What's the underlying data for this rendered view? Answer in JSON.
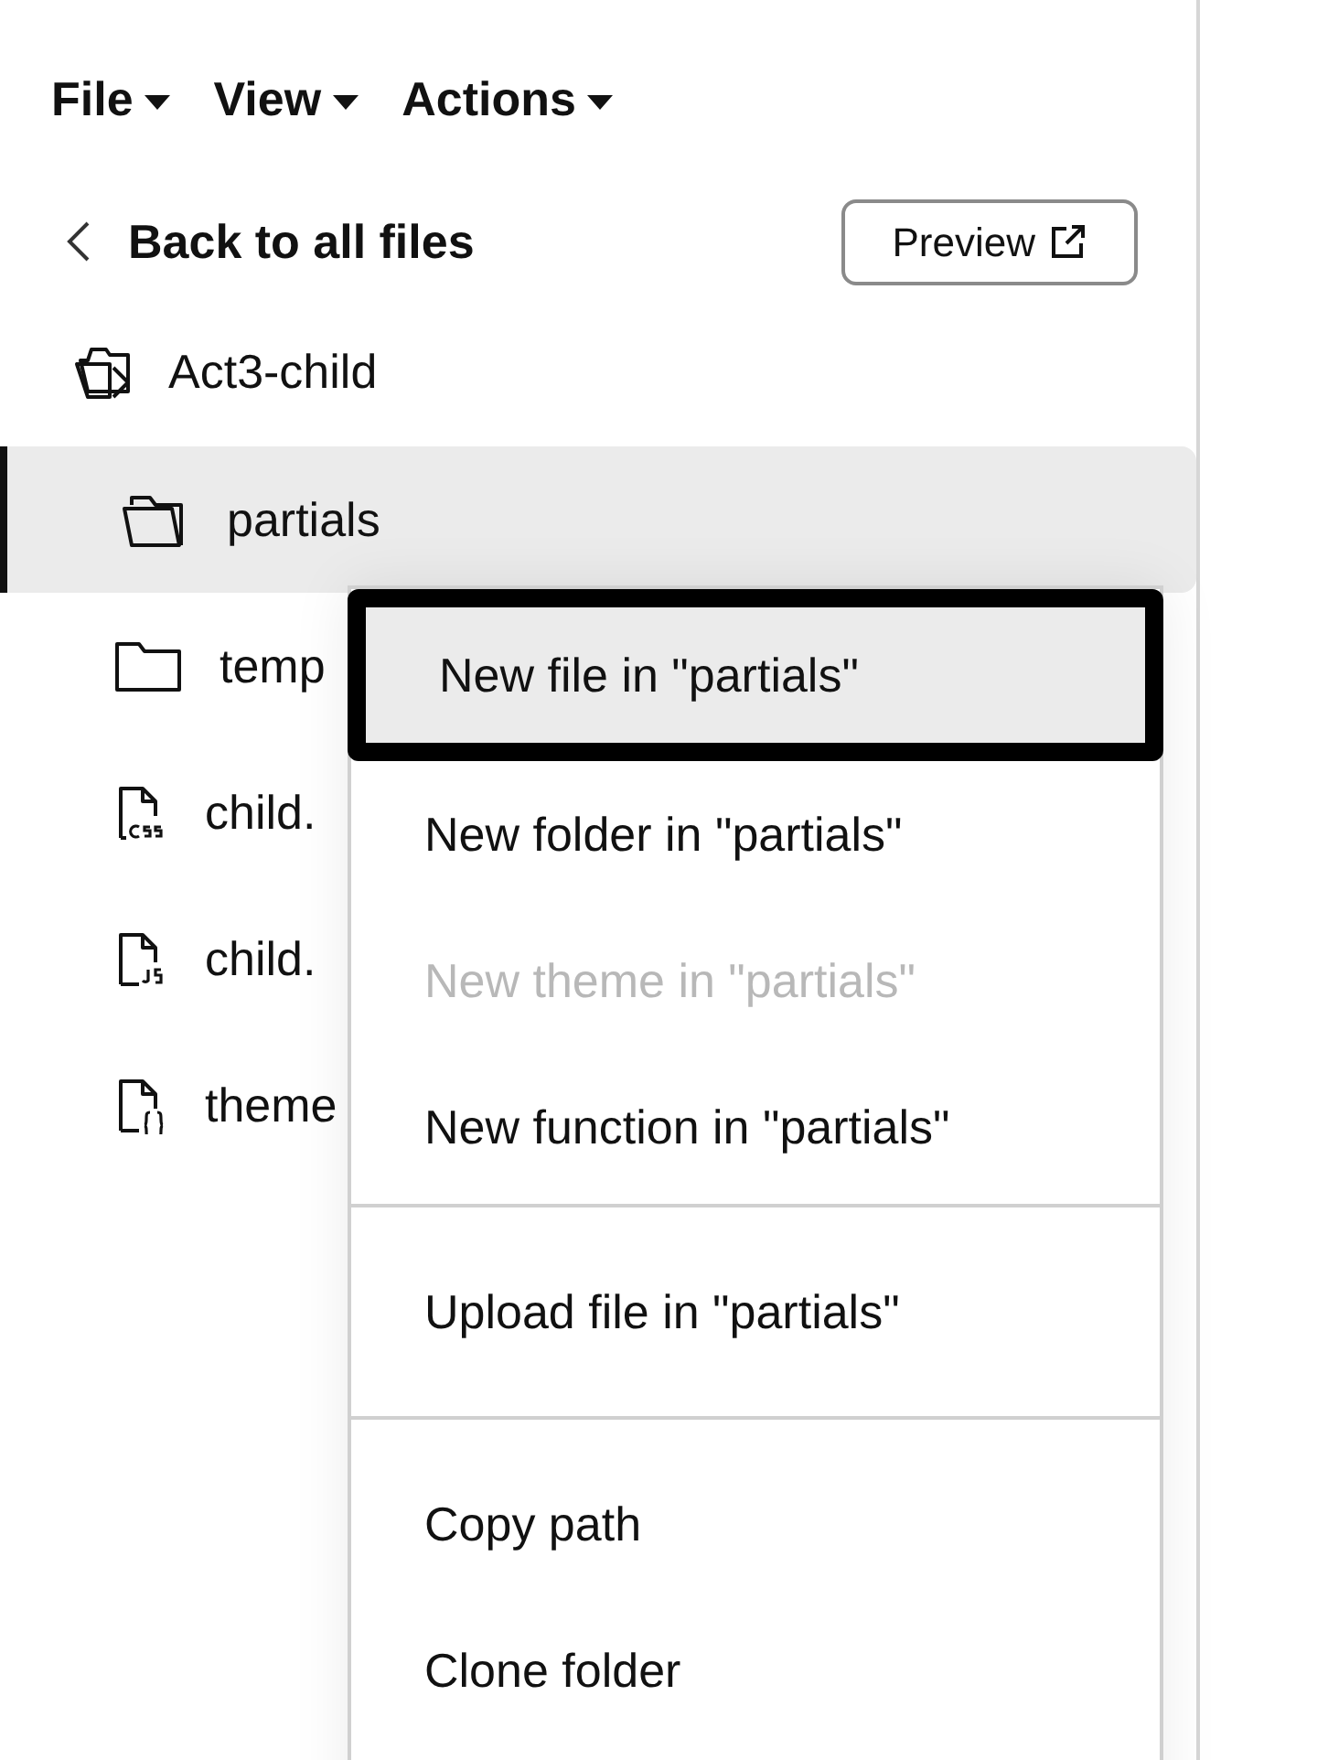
{
  "menu_bar": [
    {
      "label": "File"
    },
    {
      "label": "View"
    },
    {
      "label": "Actions"
    }
  ],
  "back_link": {
    "label": "Back to all files"
  },
  "preview_button": {
    "label": "Preview"
  },
  "tree": {
    "root": {
      "label": "Act3-child",
      "kind": "theme"
    },
    "items": [
      {
        "label": "partials",
        "kind": "folder-open",
        "selected": true
      },
      {
        "label": "temp",
        "kind": "folder",
        "selected": false
      },
      {
        "label": "child.",
        "kind": "css",
        "selected": false
      },
      {
        "label": "child.",
        "kind": "js",
        "selected": false
      },
      {
        "label": "theme",
        "kind": "json",
        "selected": false
      }
    ]
  },
  "context_menu": {
    "groups": [
      [
        {
          "label": "New file in \"partials\"",
          "selected": true,
          "disabled": false
        },
        {
          "label": "New folder in \"partials\"",
          "selected": false,
          "disabled": false
        },
        {
          "label": "New theme in \"partials\"",
          "selected": false,
          "disabled": true
        },
        {
          "label": "New function in \"partials\"",
          "selected": false,
          "disabled": false
        }
      ],
      [
        {
          "label": "Upload file in \"partials\"",
          "selected": false,
          "disabled": false
        }
      ],
      [
        {
          "label": "Copy path",
          "selected": false,
          "disabled": false
        },
        {
          "label": "Clone folder",
          "selected": false,
          "disabled": false
        }
      ]
    ]
  }
}
